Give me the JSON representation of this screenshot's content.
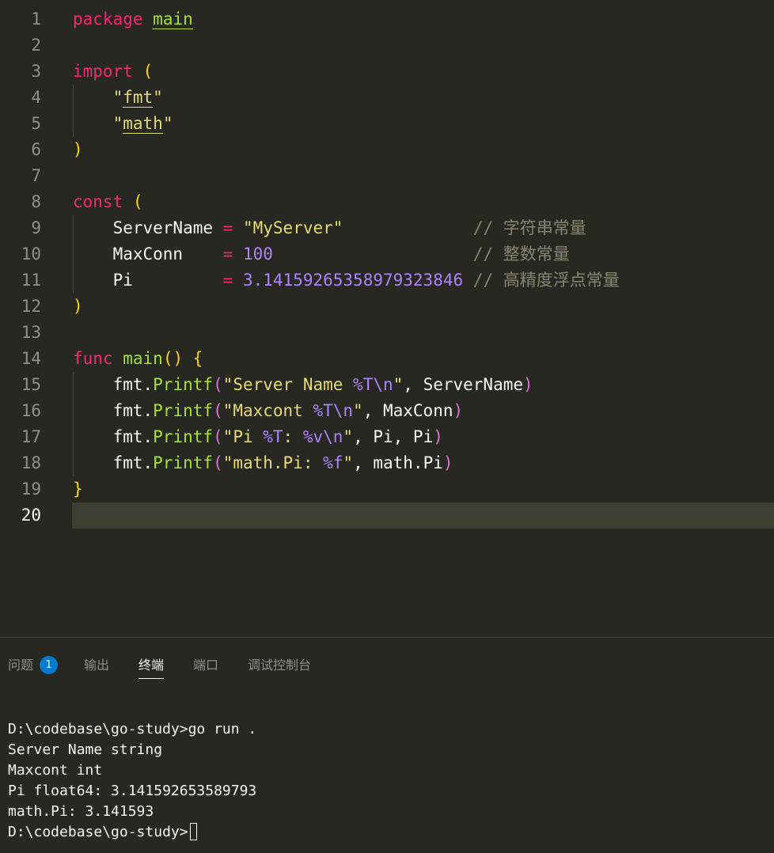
{
  "editor": {
    "line_numbers": [
      "1",
      "2",
      "3",
      "4",
      "5",
      "6",
      "7",
      "8",
      "9",
      "10",
      "11",
      "12",
      "13",
      "14",
      "15",
      "16",
      "17",
      "18",
      "19",
      "20"
    ],
    "current_line": "20",
    "tokens": {
      "package": "package",
      "main": "main",
      "import": "import",
      "lparen": "(",
      "rparen": ")",
      "q": "\"",
      "fmt": "fmt",
      "math": "math",
      "const": "const",
      "servername": "ServerName",
      "maxconn": "MaxConn",
      "pi": "Pi",
      "eq": "=",
      "myserver": "\"MyServer\"",
      "hundred": "100",
      "pival": "3.14159265358979323846",
      "cmt_slash": "//",
      "cmt1": "字符串常量",
      "cmt2": "整数常量",
      "cmt3": "高精度浮点常量",
      "func": "func",
      "main_fn": "main",
      "parens": "()",
      "lbrace": "{",
      "rbrace": "}",
      "fmtdot": "fmt.",
      "printf": "Printf",
      "s1a": "\"Server Name ",
      "s1b": "%T\\n",
      "s1c": "\"",
      "s1d": ", ServerName",
      "s2a": "\"Maxcont ",
      "s2b": "%T\\n",
      "s2c": "\"",
      "s2d": ", MaxConn",
      "s3a": "\"Pi ",
      "s3b": "%T",
      "s3c": ": ",
      "s3d": "%v\\n",
      "s3e": "\"",
      "s3f": ", Pi, Pi",
      "s4a": "\"math.Pi: ",
      "s4b": "%f",
      "s4c": "\"",
      "s4d": ", math.Pi"
    }
  },
  "panel": {
    "tabs": [
      "问题",
      "输出",
      "终端",
      "端口",
      "调试控制台"
    ],
    "active_tab": "终端",
    "problems_count": "1",
    "terminal_lines": [
      "D:\\codebase\\go-study>go run .",
      "Server Name string",
      "Maxcont int",
      "Pi float64: 3.141592653589793",
      "math.Pi: 3.141593",
      "D:\\codebase\\go-study>"
    ]
  },
  "colors": {
    "background": "#272822",
    "keyword": "#f92672",
    "function": "#a6e22e",
    "string": "#e6db74",
    "number": "#ae81ff",
    "comment": "#88846f",
    "bracket": "#ffd700",
    "badge": "#007acc"
  }
}
